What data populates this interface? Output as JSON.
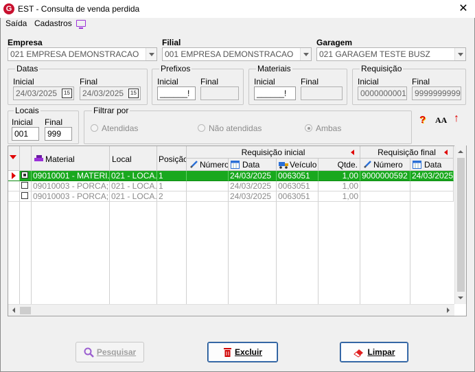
{
  "window": {
    "title": "EST - Consulta de venda perdida",
    "logo": "G",
    "close": "✕"
  },
  "menu": {
    "items": [
      "Saída",
      "Cadastros"
    ]
  },
  "empresa": {
    "label": "Empresa",
    "value": "021 EMPRESA DEMONSTRACAO"
  },
  "filial": {
    "label": "Filial",
    "value": "001 EMPRESA DEMONSTRACAO"
  },
  "garagem": {
    "label": "Garagem",
    "value": "021 GARAGEM TESTE BUSZ"
  },
  "datas": {
    "title": "Datas",
    "inicial_label": "Inicial",
    "inicial": "24/03/2025",
    "final_label": "Final",
    "final": "24/03/2025",
    "cal": "15"
  },
  "prefixos": {
    "title": "Prefixos",
    "inicial_label": "Inicial",
    "inicial": "______!",
    "final_label": "Final"
  },
  "materiais": {
    "title": "Materiais",
    "inicial_label": "Inicial",
    "inicial": "______!",
    "final_label": "Final"
  },
  "requisicao": {
    "title": "Requisição",
    "inicial_label": "Inicial",
    "inicial": "0000000001",
    "final_label": "Final",
    "final": "9999999999"
  },
  "locais": {
    "title": "Locais",
    "inicial_label": "Inicial",
    "inicial": "001",
    "final_label": "Final",
    "final": "999"
  },
  "filtrar": {
    "title": "Filtrar por",
    "options": [
      "Atendidas",
      "Não atendidas",
      "Ambas"
    ],
    "selected": "Ambas"
  },
  "toolbar_icons": {
    "help": "?",
    "font": "AA",
    "up": "↑"
  },
  "grid": {
    "headers": {
      "material": "Material",
      "local": "Local",
      "posicao": "Posição",
      "req_inicial": "Requisição inicial",
      "req_final": "Requisição final",
      "numero": "Número",
      "data": "Data",
      "veiculo": "Veículo",
      "qtde": "Qtde.",
      "numero2": "Número",
      "data2": "Data"
    },
    "rows": [
      {
        "material": "09010001 - MATERI...",
        "local": "021 - LOCA...",
        "posicao": "1",
        "numero": "",
        "data": "24/03/2025",
        "veiculo": "0063051",
        "qtde": "1,00",
        "numero2": "9000000592",
        "data2": "24/03/2025",
        "checked": true,
        "selected": true
      },
      {
        "material": "09010003 - PORCA; ...",
        "local": "021 - LOCA...",
        "posicao": "1",
        "numero": "",
        "data": "24/03/2025",
        "veiculo": "0063051",
        "qtde": "1,00",
        "numero2": "",
        "data2": "",
        "checked": false,
        "selected": false
      },
      {
        "material": "09010003 - PORCA; ...",
        "local": "021 - LOCA...",
        "posicao": "2",
        "numero": "",
        "data": "24/03/2025",
        "veiculo": "0063051",
        "qtde": "1,00",
        "numero2": "",
        "data2": "",
        "checked": false,
        "selected": false
      }
    ]
  },
  "buttons": {
    "pesquisar": "Pesquisar",
    "excluir": "Excluir",
    "limpar": "Limpar"
  },
  "colors": {
    "selected_row": "#19a81e",
    "accent_red": "#e00000",
    "logo": "#c8102e",
    "monitor": "#9b30d9"
  }
}
